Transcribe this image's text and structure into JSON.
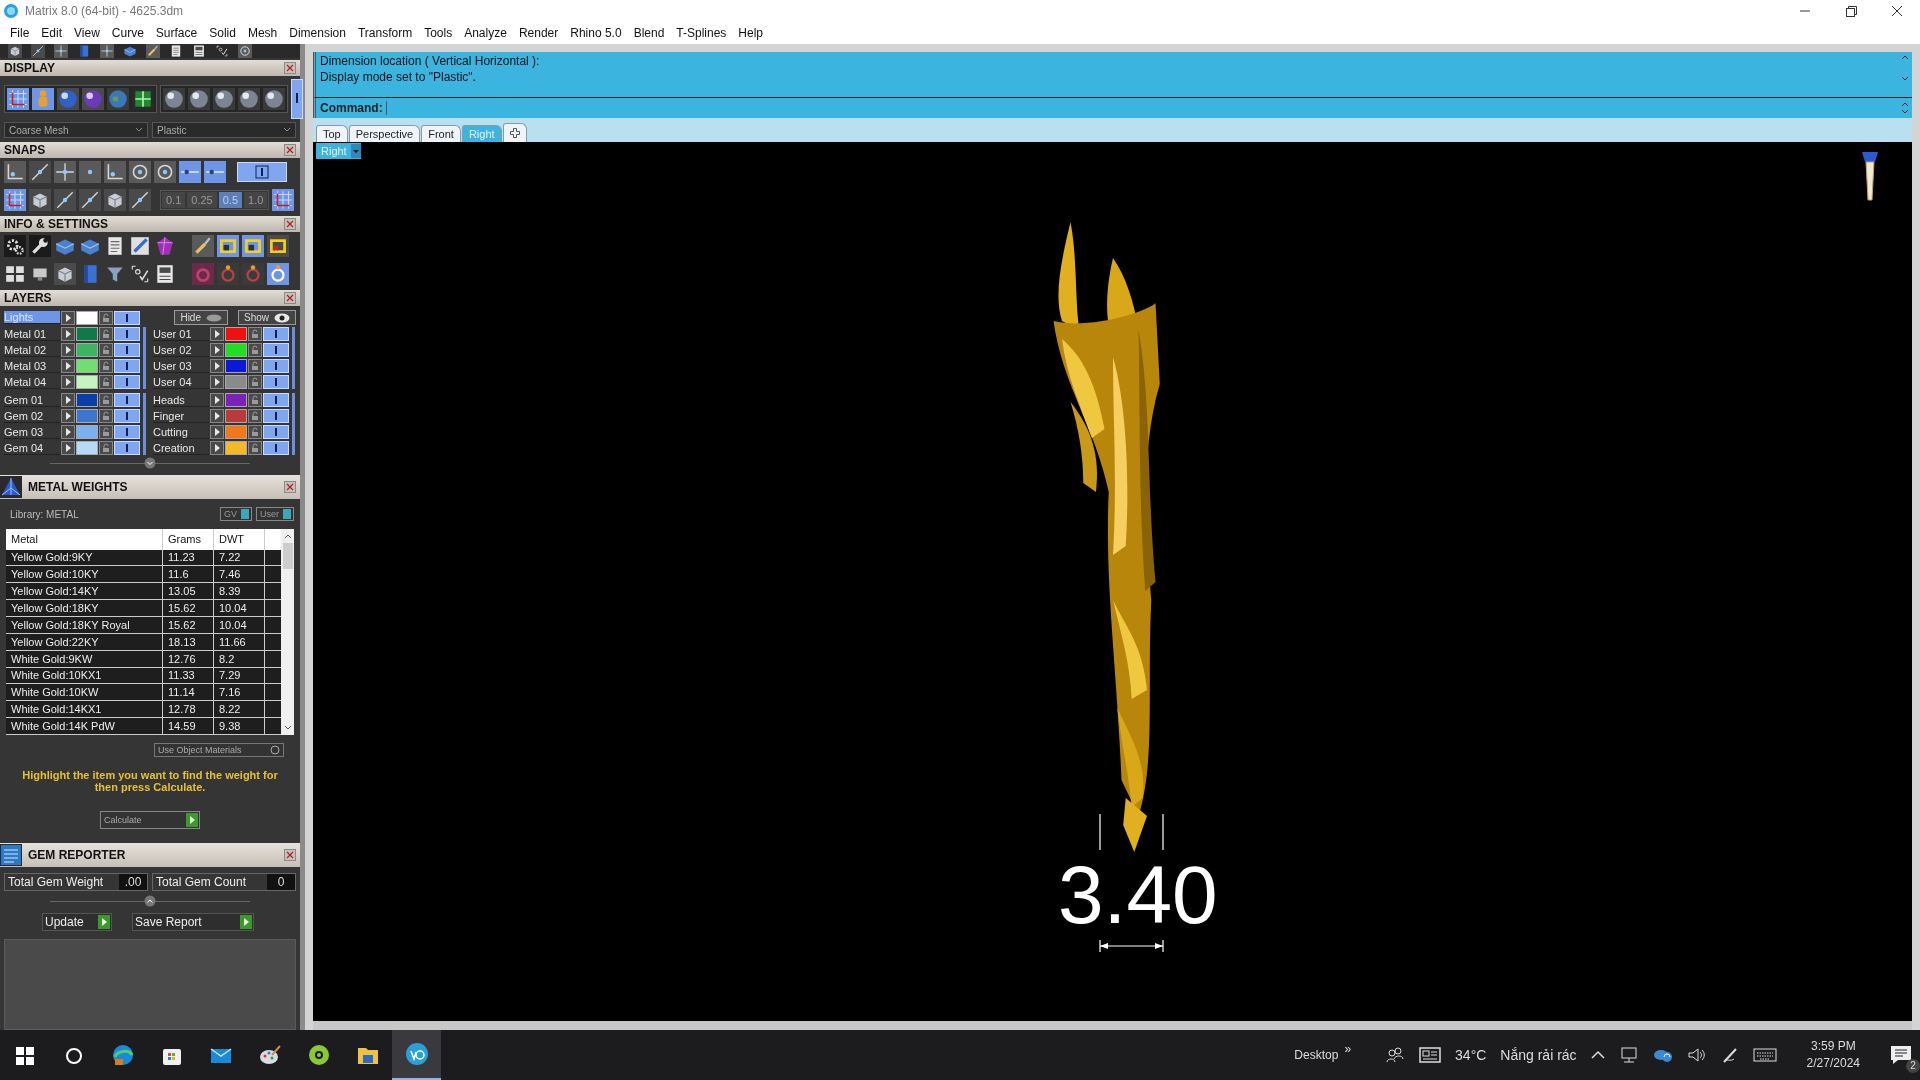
{
  "window": {
    "title": "Matrix 8.0 (64-bit) - 4625.3dm"
  },
  "menu": [
    "File",
    "Edit",
    "View",
    "Curve",
    "Surface",
    "Solid",
    "Mesh",
    "Dimension",
    "Transform",
    "Tools",
    "Analyze",
    "Render",
    "Rhino 5.0",
    "Blend",
    "T-Splines",
    "Help"
  ],
  "display": {
    "title": "DISPLAY",
    "mesh_dropdown": "Coarse Mesh",
    "mode_dropdown": "Plastic"
  },
  "snaps": {
    "title": "SNAPS",
    "values": [
      {
        "label": "0.1",
        "selected": false
      },
      {
        "label": "0.25",
        "selected": false
      },
      {
        "label": "0.5",
        "selected": true
      },
      {
        "label": "1.0",
        "selected": false
      }
    ]
  },
  "info_settings": {
    "title": "INFO & SETTINGS"
  },
  "layers": {
    "title": "LAYERS",
    "lights": {
      "label": "Lights",
      "color": "#ffffff",
      "selected": true
    },
    "hide": "Hide",
    "show": "Show",
    "left": [
      [
        {
          "name": "Metal 01",
          "color": "#0e7a4a"
        },
        {
          "name": "Metal 02",
          "color": "#3cb563"
        },
        {
          "name": "Metal 03",
          "color": "#6fe06f"
        },
        {
          "name": "Metal 04",
          "color": "#c2f5c0"
        }
      ],
      [
        {
          "name": "Gem 01",
          "color": "#0a3ea8"
        },
        {
          "name": "Gem 02",
          "color": "#3a78d0"
        },
        {
          "name": "Gem 03",
          "color": "#78b0f0"
        },
        {
          "name": "Gem 04",
          "color": "#b8d8fa"
        }
      ]
    ],
    "right": [
      [
        {
          "name": "User 01",
          "color": "#ee1111"
        },
        {
          "name": "User 02",
          "color": "#22dd22"
        },
        {
          "name": "User 03",
          "color": "#0a18d8"
        },
        {
          "name": "User 04",
          "color": "#8a8a8a"
        }
      ],
      [
        {
          "name": "Heads",
          "color": "#7a22b8"
        },
        {
          "name": "Finger",
          "color": "#b83a3a"
        },
        {
          "name": "Cutting",
          "color": "#f07818"
        },
        {
          "name": "Creation",
          "color": "#f5b828"
        }
      ]
    ]
  },
  "metal_weights": {
    "title": "METAL WEIGHTS",
    "library": "Library: METAL",
    "toggles": [
      "GV",
      "User"
    ],
    "columns": [
      "Metal",
      "Grams",
      "DWT"
    ],
    "rows": [
      [
        "Yellow Gold:9KY",
        "11.23",
        "7.22"
      ],
      [
        "Yellow Gold:10KY",
        "11.6",
        "7.46"
      ],
      [
        "Yellow Gold:14KY",
        "13.05",
        "8.39"
      ],
      [
        "Yellow Gold:18KY",
        "15.62",
        "10.04"
      ],
      [
        "Yellow Gold:18KY Royal",
        "15.62",
        "10.04"
      ],
      [
        "Yellow Gold:22KY",
        "18.13",
        "11.66"
      ],
      [
        "White Gold:9KW",
        "12.76",
        "8.2"
      ],
      [
        "White Gold:10KX1",
        "11.33",
        "7.29"
      ],
      [
        "White Gold:10KW",
        "11.14",
        "7.16"
      ],
      [
        "White Gold:14KX1",
        "12.78",
        "8.22"
      ],
      [
        "White Gold:14K PdW",
        "14.59",
        "9.38"
      ]
    ],
    "materials_button": "Use Object Materials",
    "hint": "Highlight the item you want to find the weight for then press Calculate.",
    "calculate": "Calculate"
  },
  "gem_reporter": {
    "title": "GEM REPORTER",
    "fields": [
      {
        "label": "Total Gem Weight",
        "value": ".00"
      },
      {
        "label": "Total Gem Count",
        "value": "0"
      }
    ],
    "buttons": [
      "Update",
      "Save Report"
    ]
  },
  "command": {
    "lines": [
      "Dimension location ( Vertical  Horizontal ):",
      "Display mode set to \"Plastic\"."
    ],
    "prompt": "Command:"
  },
  "viewport": {
    "tabs": [
      {
        "label": "Top",
        "selected": false
      },
      {
        "label": "Perspective",
        "selected": false
      },
      {
        "label": "Front",
        "selected": false
      },
      {
        "label": "Right",
        "selected": true
      }
    ],
    "label": "Right",
    "dimension": "3.40"
  },
  "taskbar": {
    "desktop": "Desktop",
    "chevron": "»",
    "temperature": "34°C",
    "weather": "Nắng rải rác",
    "time": "3:59 PM",
    "date": "2/27/2024",
    "notifications": "2"
  }
}
